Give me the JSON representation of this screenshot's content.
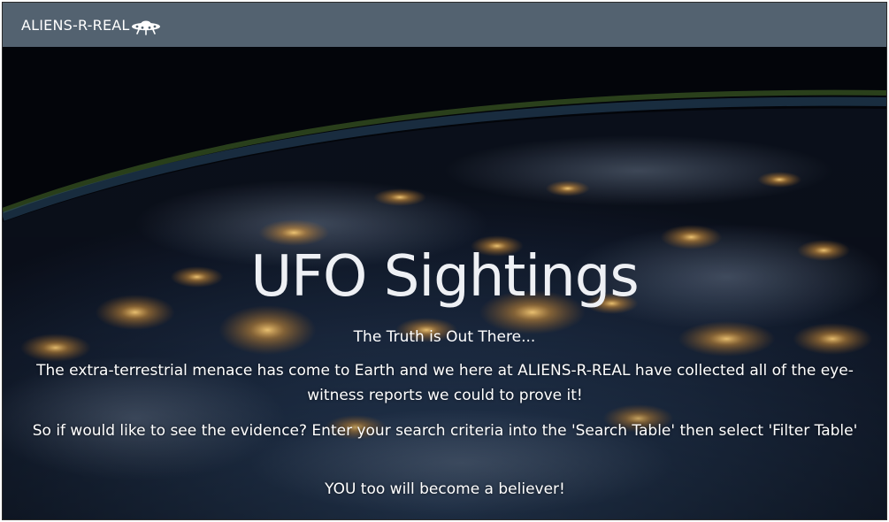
{
  "navbar": {
    "brand_label": "ALIENS-R-REAL",
    "brand_icon": "ufo-icon",
    "background_color": "#536270"
  },
  "hero": {
    "background": "night-earth-from-space-image",
    "title": "UFO Sightings",
    "tagline": "The Truth is Out There...",
    "paragraphs": [
      "The extra-terrestrial menace has come to Earth and we here at ALIENS-R-REAL have collected all of the eye-witness reports we could to prove it!",
      "So if would like to see the evidence? Enter your search criteria into the 'Search Table' then select 'Filter Table'",
      "YOU too will become a believer!"
    ]
  }
}
